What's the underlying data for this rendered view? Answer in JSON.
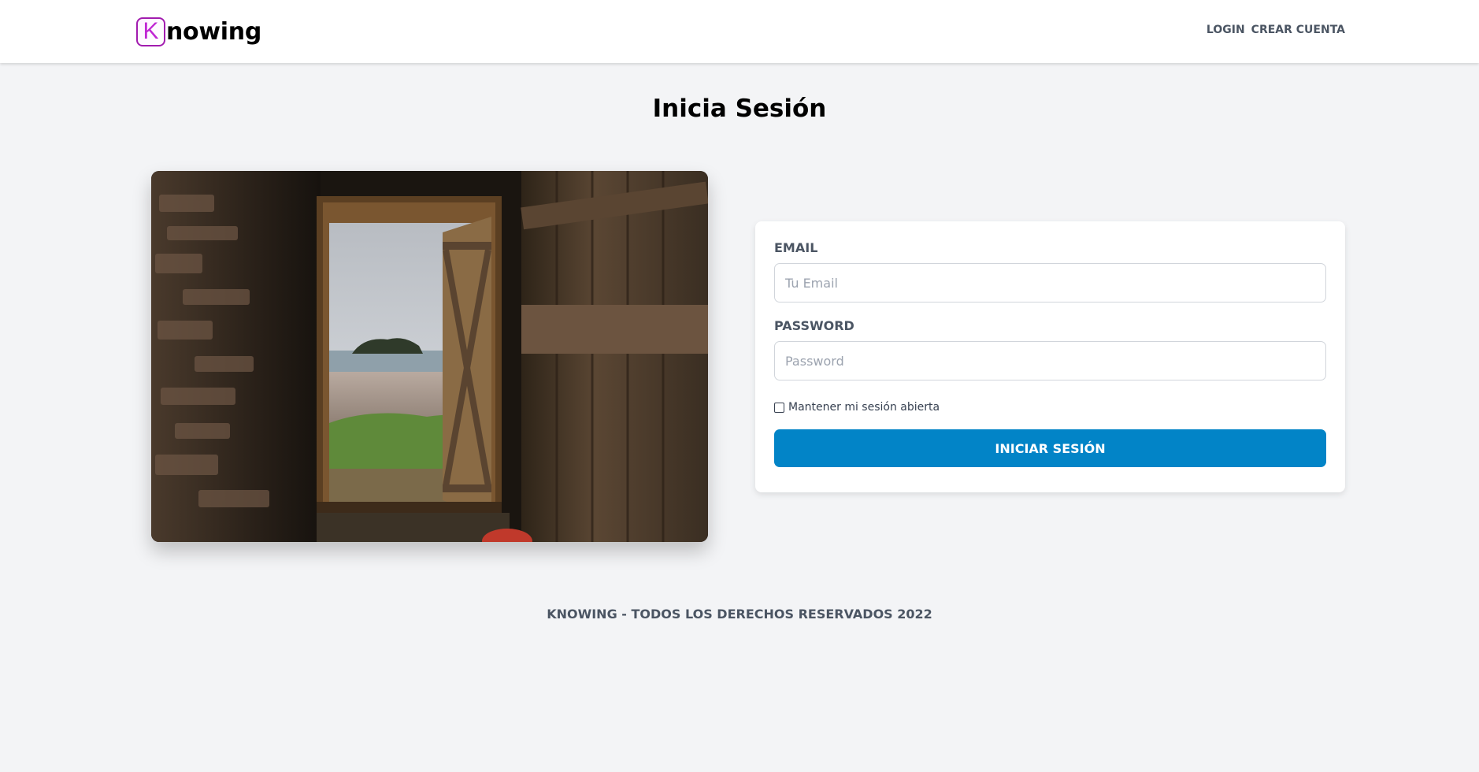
{
  "brand": {
    "logo_letter": "K",
    "logo_text": "nowing",
    "accent_color": "#c026d3"
  },
  "nav": {
    "items": [
      {
        "label": "LOGIN"
      },
      {
        "label": "CREAR CUENTA"
      }
    ]
  },
  "page": {
    "title": "Inicia Sesión"
  },
  "hero_image": {
    "icon": "barn-door-photo",
    "alt": "Puerta de madera abierta hacia la playa"
  },
  "form": {
    "email": {
      "label": "EMAIL",
      "placeholder": "Tu Email",
      "value": ""
    },
    "password": {
      "label": "PASSWORD",
      "placeholder": "Password",
      "value": ""
    },
    "remember": {
      "label": "Mantener mi sesión abierta",
      "checked": false
    },
    "submit_label": "INICIAR SESIÓN",
    "submit_color": "#0284c7"
  },
  "footer": {
    "text": "KNOWING - TODOS LOS DERECHOS RESERVADOS 2022"
  }
}
